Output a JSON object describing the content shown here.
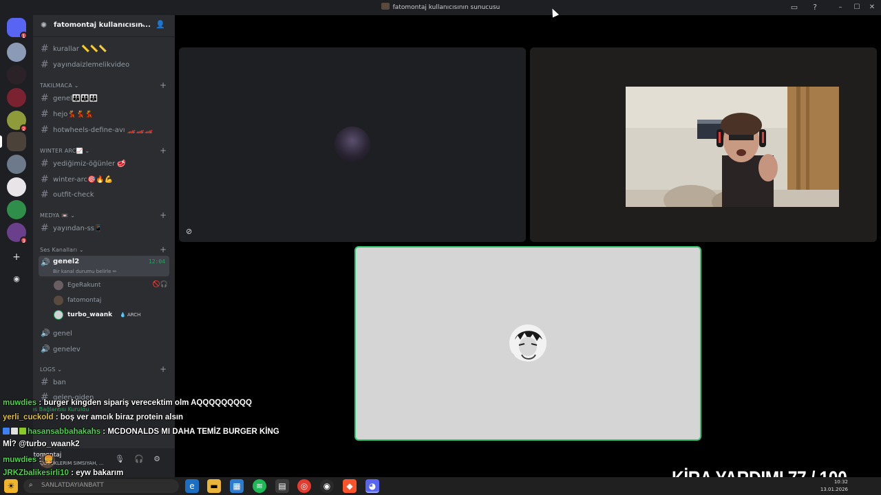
{
  "window": {
    "title": "fatomontaj kullanıcısının sunucusu"
  },
  "server": {
    "name": "fatomontaj kullanıcısın...",
    "badge_top": "1",
    "badge_2": "2",
    "badge_3": "3"
  },
  "channels_top": [
    {
      "label": "kurallar 📏📏📏"
    },
    {
      "label": "yayındaizlemelikvideo"
    }
  ],
  "categories": {
    "takilmaca": "TAKILMACA ⌄",
    "winter_arc": "WINTER ARC📈 ⌄",
    "medya": "MEDYA 📼 ⌄",
    "ses_kanallari": "Ses Kanalları ⌄",
    "logs": "LOGS ⌄"
  },
  "takilmaca_channels": [
    {
      "label": "genel👨‍👩‍👦👨‍👩‍👦👨‍👩‍👦"
    },
    {
      "label": "hejo💃💃💃"
    },
    {
      "label": "hotwheels-define-avı 🏎️🏎️🏎️"
    }
  ],
  "winter_channels": [
    {
      "label": "yediğimiz-öğünler 🥩"
    },
    {
      "label": "winter-arc🎯🔥💪"
    },
    {
      "label": "outfit-check"
    }
  ],
  "medya_channels": [
    {
      "label": "yayından-ss📱"
    }
  ],
  "voice": {
    "active_channel": "genel2",
    "timer": "12:04",
    "status": "Bir kanal durumu belirle ✏",
    "members": [
      {
        "name": "EgeRakunt"
      },
      {
        "name": "fatomontaj"
      },
      {
        "name": "turbo_waank",
        "tag": "💧 ARCH"
      }
    ],
    "other_channels": [
      {
        "label": "genel"
      },
      {
        "label": "genelev"
      }
    ]
  },
  "logs_channels": [
    {
      "label": "ban"
    },
    {
      "label": "gelen-giden"
    }
  ],
  "connection": {
    "label": "Ses Bağlantısı Kuruldu"
  },
  "user_panel": {
    "name": "fatomontaj",
    "status": "ÇOCUKLERIM SIMSIYAH, ..."
  },
  "chat": [
    {
      "user": "muwdies",
      "sep": " : ",
      "text": "burger kingden sipariş verecektim olm AQQQQQQQQQ"
    },
    {
      "user": "yerli_cuckold",
      "sep": " : ",
      "text": "boş ver amcık biraz protein alsın"
    },
    {
      "user": "hasansabbahakahs",
      "sep": " : ",
      "text": "MCDONALDS MI DAHA TEMİZ BURGER KİNG"
    },
    {
      "text": "Mİ? @turbo_waank2"
    },
    {
      "user": "muwdies",
      "sep": " : ",
      "text": "🍔"
    },
    {
      "user": "JRKZbalikesirli10",
      "sep": " : ",
      "text": "eyw bakarım"
    }
  ],
  "goal": {
    "text": "KİRA YARDIMI",
    "current": 77,
    "target": 100,
    "display": "KİRA YARDIMI  77 / 100"
  },
  "taskbar": {
    "search_placeholder": "SANLATDAYIANBATT",
    "time": "10:32",
    "date": "13.01.2026"
  },
  "colors": {
    "accent_green": "#23a55a",
    "speaking_border": "#2dc770",
    "chat_green": "#4cd64c",
    "chat_yellow": "#e3c433"
  }
}
